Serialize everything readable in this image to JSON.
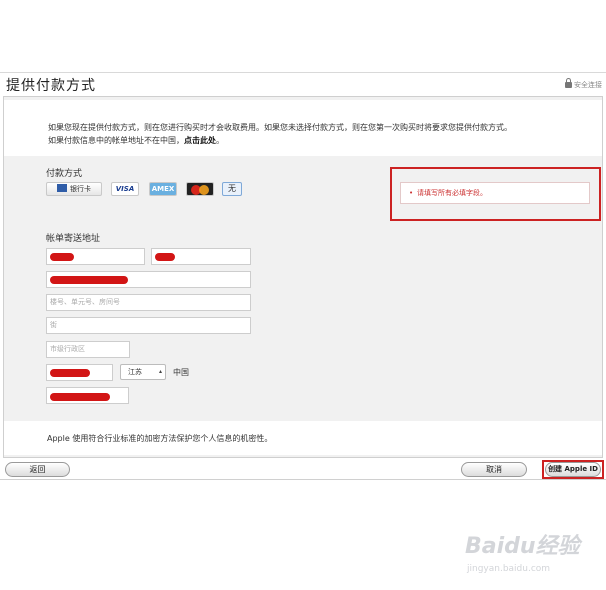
{
  "page": {
    "title": "提供付款方式",
    "secure_label": "安全连接"
  },
  "notice": {
    "line1": "如果您现在提供付款方式，则在您进行购买时才会收取费用。如果您未选择付款方式，则在您第一次购买时将要求您提供付款方式。",
    "line2_prefix": "如果付款信息中的帐单地址不在中国，",
    "line2_link": "点击此处",
    "line2_suffix": "。"
  },
  "payment": {
    "label": "付款方式",
    "options": [
      {
        "name": "bank-card",
        "label": "银行卡"
      },
      {
        "name": "visa",
        "label": "VISA"
      },
      {
        "name": "amex",
        "label": "AMEX"
      },
      {
        "name": "mastercard",
        "label": ""
      },
      {
        "name": "none",
        "label": "无",
        "selected": true
      }
    ]
  },
  "error": {
    "message": "请填写所有必填字段。",
    "color": "#cc2222"
  },
  "billing": {
    "label": "帐单寄送地址",
    "address_line2_placeholder": "楼号、单元号、房间号",
    "district_placeholder": "街",
    "city_placeholder": "市级行政区",
    "province": "江苏",
    "country": "中国"
  },
  "footer": {
    "privacy_text": "Apple 使用符合行业标准的加密方法保护您个人信息的机密性。",
    "back_label": "返回",
    "cancel_label": "取消",
    "create_label": "创建 Apple ID"
  },
  "watermark": {
    "logo": "Baidu经验",
    "url": "jingyan.baidu.com"
  }
}
